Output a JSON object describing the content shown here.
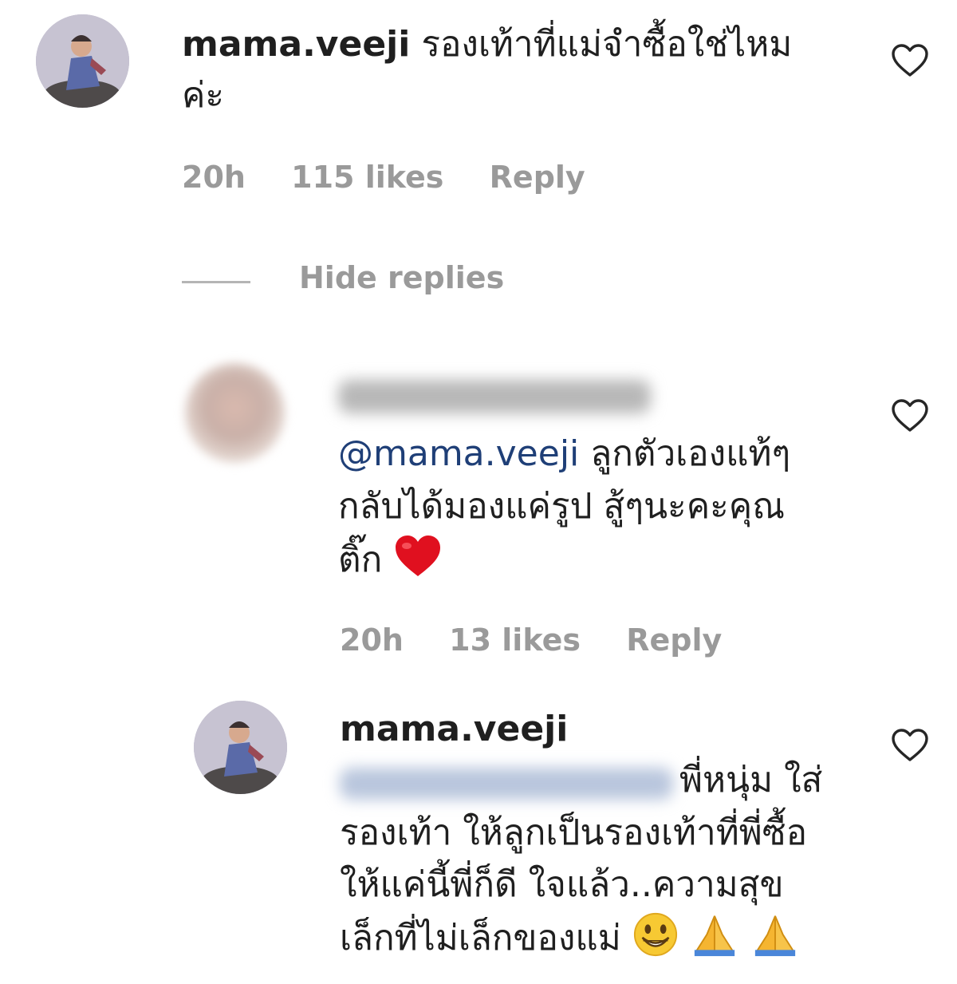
{
  "comment": {
    "username": "mama.veeji",
    "text_line1": "รองเท้าที่แม่จำซื้อใช่ไหม",
    "text_line2": "ค่ะ",
    "time": "20h",
    "likes": "115 likes",
    "reply": "Reply"
  },
  "hide_replies": "Hide replies",
  "reply1": {
    "mention": "@mama.veeji",
    "text_line1": "ลูกตัวเองแท้ๆ",
    "text_line2": "กลับได้มองแค่รูป สู้ๆนะคะคุณ",
    "text_line3": "ติ๊ก",
    "time": "20h",
    "likes": "13 likes",
    "reply": "Reply"
  },
  "reply2": {
    "username": "mama.veeji",
    "text_line1": "พี่หนุ่ม ใส่",
    "text_line2": "รองเท้า ให้ลูกเป็นรองเท้าที่พี่ซื้อ",
    "text_line3": "ให้แค่นี้พี่ก็ดี ใจแล้ว..ความสุข",
    "text_line4": "เล็กที่ไม่เล็กของแม่"
  },
  "icons": {
    "like": "heart-outline-icon",
    "emoji_heart": "red-heart-emoji",
    "emoji_grin": "grinning-face-emoji",
    "emoji_pray": "folded-hands-emoji"
  }
}
